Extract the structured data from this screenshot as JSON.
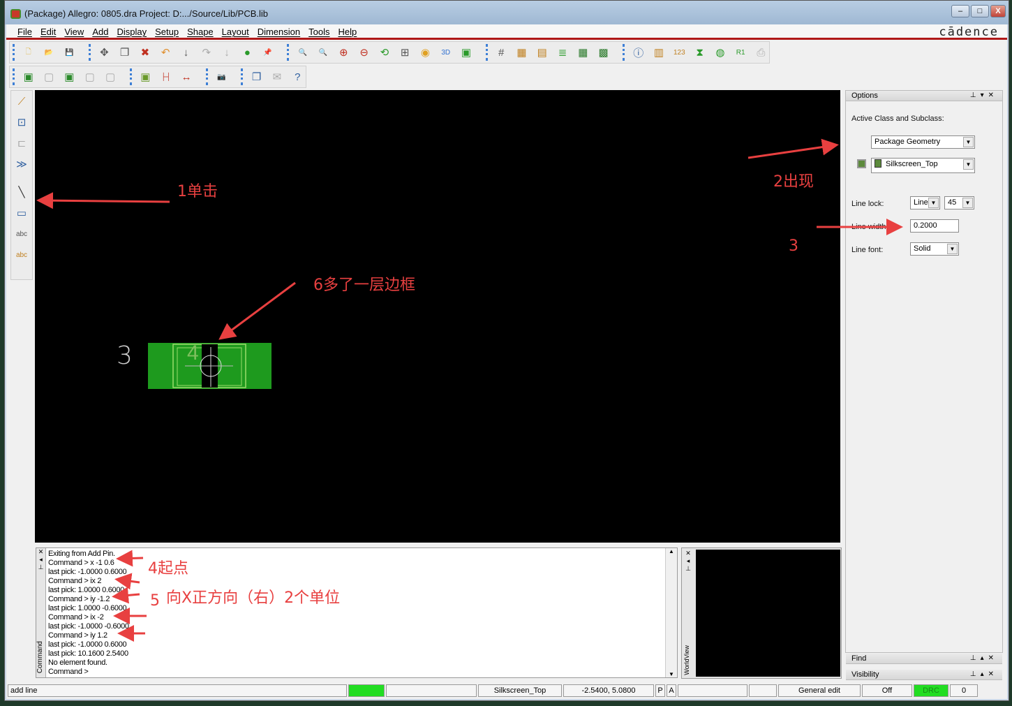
{
  "window": {
    "title": "(Package) Allegro: 0805.dra  Project: D:.../Source/Lib/PCB.lib",
    "controls": [
      "–",
      "□",
      "X"
    ]
  },
  "menu": [
    "File",
    "Edit",
    "View",
    "Add",
    "Display",
    "Setup",
    "Shape",
    "Layout",
    "Dimension",
    "Tools",
    "Help"
  ],
  "brand": "cādence",
  "toolbar1": [
    [
      "new-icon",
      "🗋",
      "#e0b850"
    ],
    [
      "open-icon",
      "📂",
      "#e0b850"
    ],
    [
      "save-icon",
      "💾",
      "#4060a0"
    ],
    [
      "move-icon",
      "✥",
      "#555"
    ],
    [
      "copy-icon",
      "❐",
      "#555"
    ],
    [
      "delete-icon",
      "✖",
      "#c03020"
    ],
    [
      "undo-icon",
      "↶",
      "#e09030"
    ],
    [
      "redo-down-icon",
      "↓",
      "#555"
    ],
    [
      "redo-icon",
      "↷",
      "#aaa"
    ],
    [
      "down-icon",
      "↓",
      "#aaa"
    ],
    [
      "shape-icon",
      "●",
      "#2a9a2a"
    ],
    [
      "pin-icon",
      "📌",
      "#2a9a2a"
    ],
    [
      "zoom-fit-icon",
      "🔍",
      "#555"
    ],
    [
      "zoom-window-icon",
      "🔍",
      "#c03020"
    ],
    [
      "zoom-in-icon",
      "⊕",
      "#c03020"
    ],
    [
      "zoom-out-icon",
      "⊖",
      "#c03020"
    ],
    [
      "zoom-previous-icon",
      "⟲",
      "#2a9a2a"
    ],
    [
      "zoom-world-icon",
      "⊞",
      "#555"
    ],
    [
      "redraw-icon",
      "◉",
      "#e0a020"
    ],
    [
      "3d-icon",
      "3D",
      "#3070d0"
    ],
    [
      "flip-icon",
      "▣",
      "#2a9a2a"
    ],
    [
      "grid-icon",
      "#",
      "#555"
    ],
    [
      "color-icon",
      "▦",
      "#c08020"
    ],
    [
      "layers-icon",
      "▤",
      "#c08020"
    ],
    [
      "stack-icon",
      "≣",
      "#2a9a2a"
    ],
    [
      "ecm-icon",
      "▦",
      "#2a7a2a"
    ],
    [
      "constraint-icon",
      "▩",
      "#2a7a2a"
    ],
    [
      "info-icon",
      "ⓘ",
      "#3060a0"
    ],
    [
      "properties-icon",
      "▥",
      "#c08020"
    ],
    [
      "measure-icon",
      "123",
      "#c08020"
    ],
    [
      "hourglass-icon",
      "⧗",
      "#2a9a2a"
    ],
    [
      "report-icon",
      "◍",
      "#2a9a2a"
    ],
    [
      "drc-icon",
      "R1",
      "#2a9a2a"
    ],
    [
      "print-icon",
      "⎙",
      "#aaa"
    ]
  ],
  "toolbar2": [
    [
      "board-icon",
      "▣",
      "#2a8a2a"
    ],
    [
      "disabled-icon-1",
      "▢",
      "#aaa"
    ],
    [
      "board-route-icon",
      "▣",
      "#2a8a2a"
    ],
    [
      "disabled-icon-2",
      "▢",
      "#aaa"
    ],
    [
      "disabled-icon-3",
      "▢",
      "#aaa"
    ],
    [
      "component-icon",
      "▣",
      "#6a9a2a"
    ],
    [
      "dimension-icon",
      "├┤",
      "#c03020"
    ],
    [
      "dimension-horizontal-icon",
      "↔",
      "#c03020"
    ],
    [
      "camera-icon",
      "📷",
      "#555"
    ],
    [
      "windows-icon",
      "❐",
      "#3060a0"
    ],
    [
      "disabled-icon-4",
      "✉",
      "#aaa"
    ],
    [
      "help-icon",
      "?",
      "#3060a0"
    ]
  ],
  "lefttoolbar": [
    [
      "add-connect-icon",
      "⟋",
      "#c08020"
    ],
    [
      "slide-icon",
      "⊡",
      "#3060a0"
    ],
    [
      "disabled-route-icon",
      "⊏",
      "#aaa"
    ],
    [
      "route-icon",
      "≫",
      "#3060a0"
    ],
    [
      "add-line-icon",
      "╲",
      "#333"
    ],
    [
      "add-rect-icon",
      "▭",
      "#3060a0"
    ],
    [
      "add-text-icon",
      "abc",
      "#555"
    ],
    [
      "edit-text-icon",
      "abc",
      "#c08020"
    ]
  ],
  "options": {
    "header": "Options",
    "active_label": "Active Class and Subclass:",
    "class": "Package Geometry",
    "subclass": "Silkscreen_Top",
    "line_lock_label": "Line lock:",
    "line_lock": "Line",
    "angle": "45",
    "line_width_label": "Line width:",
    "line_width": "0.2000",
    "line_font_label": "Line font:",
    "line_font": "Solid",
    "subclass_color": "#5c8a3c"
  },
  "panels": {
    "find": "Find",
    "visibility": "Visibility",
    "command_tab": "Command",
    "worldview_tab": "WorldView"
  },
  "canvas": {
    "pin_labels": [
      "3",
      "4"
    ]
  },
  "command_lines": [
    "Exiting from Add Pin.",
    "Command > x -1 0.6",
    "last pick:  -1.0000  0.6000",
    "Command > ix 2",
    "last pick:  1.0000  0.6000",
    "Command > iy -1.2",
    "last pick:  1.0000  -0.6000",
    "Command > ix -2",
    "last pick:  -1.0000  -0.6000",
    "Command > iy 1.2",
    "last pick:  -1.0000  0.6000",
    "last pick:  10.1600  2.5400",
    "No element found.",
    "Command >"
  ],
  "status": {
    "command": "add line",
    "subclass": "Silkscreen_Top",
    "coords": "-2.5400, 5.0800",
    "p": "P",
    "a": "A",
    "mode": "General edit",
    "off": "Off",
    "drc": "DRC",
    "count": "0",
    "ready_color": "#22dd22"
  },
  "annotations": {
    "a1": "1单击",
    "a2": "2出现",
    "a3": "3",
    "a4": "4起点",
    "a5": "5",
    "a5b": "向X正方向（右）2个单位",
    "a6": "6多了一层边框",
    "color": "#e84040"
  }
}
